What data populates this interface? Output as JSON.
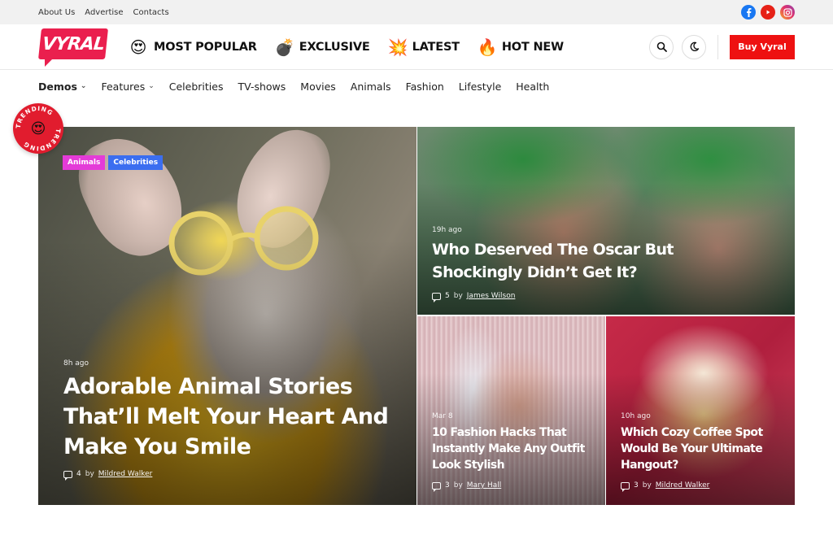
{
  "topbar": {
    "links": [
      "About Us",
      "Advertise",
      "Contacts"
    ],
    "socials": [
      "facebook-icon",
      "youtube-icon",
      "instagram-icon"
    ]
  },
  "header": {
    "logo_text": "VYRAL",
    "nav": [
      {
        "emoji": "😍",
        "label": "MOST POPULAR"
      },
      {
        "emoji": "💣",
        "label": "EXCLUSIVE"
      },
      {
        "emoji": "💥",
        "label": "LATEST"
      },
      {
        "emoji": "🔥",
        "label": "HOT NEW"
      }
    ],
    "buy_label": "Buy Vyral"
  },
  "categories": [
    {
      "label": "Demos",
      "dropdown": true
    },
    {
      "label": "Features",
      "dropdown": true
    },
    {
      "label": "Celebrities",
      "dropdown": false
    },
    {
      "label": "TV-shows",
      "dropdown": false
    },
    {
      "label": "Movies",
      "dropdown": false
    },
    {
      "label": "Animals",
      "dropdown": false
    },
    {
      "label": "Fashion",
      "dropdown": false
    },
    {
      "label": "Lifestyle",
      "dropdown": false
    },
    {
      "label": "Health",
      "dropdown": false
    }
  ],
  "trending_badge": {
    "text": "TRENDING",
    "emoji": "😍"
  },
  "colors": {
    "brand": "#ea1f4e",
    "buy": "#ee1111",
    "tag_animals": "#e43bd8",
    "tag_celebrities": "#3b6ef0"
  },
  "posts": [
    {
      "tags": [
        "Animals",
        "Celebrities"
      ],
      "time": "8h ago",
      "title": "Adorable Animal Stories That’ll Melt Your Heart And Make You Smile",
      "comments": "4",
      "by": "by",
      "author": "Mildred Walker"
    },
    {
      "time": "19h ago",
      "title": "Who Deserved The Oscar But Shockingly Didn’t Get It?",
      "comments": "5",
      "by": "by",
      "author": "James Wilson"
    },
    {
      "time": "Mar 8",
      "title": "10 Fashion Hacks That Instantly Make Any Outfit Look Stylish",
      "comments": "3",
      "by": "by",
      "author": "Mary Hall"
    },
    {
      "time": "10h ago",
      "title": "Which Cozy Coffee Spot Would Be Your Ultimate Hangout?",
      "comments": "3",
      "by": "by",
      "author": "Mildred Walker"
    }
  ]
}
